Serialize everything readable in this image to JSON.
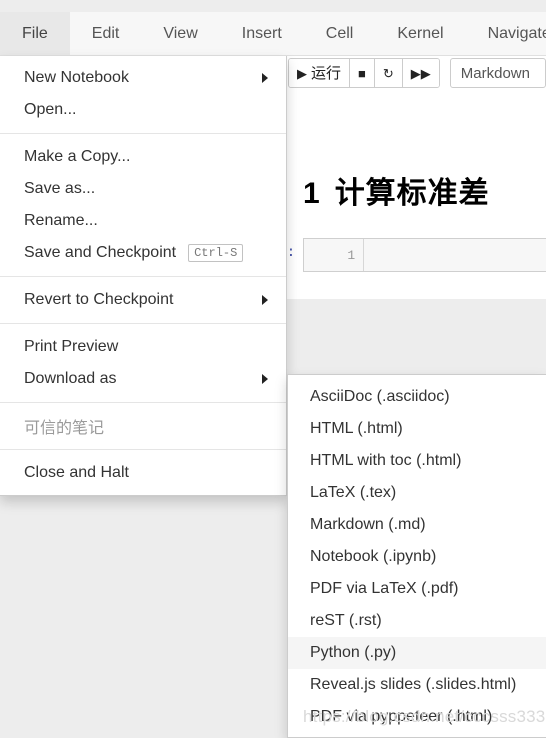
{
  "menubar": {
    "items": [
      {
        "label": "File",
        "active": true
      },
      {
        "label": "Edit",
        "active": false
      },
      {
        "label": "View",
        "active": false
      },
      {
        "label": "Insert",
        "active": false
      },
      {
        "label": "Cell",
        "active": false
      },
      {
        "label": "Kernel",
        "active": false
      },
      {
        "label": "Navigate",
        "active": false
      }
    ]
  },
  "toolbar": {
    "run_glyph": "▶",
    "run_label": "运行",
    "stop_glyph": "■",
    "restart_glyph": "↻",
    "runall_glyph": "▶▶",
    "celltype_value": "Markdown"
  },
  "notebook": {
    "heading_number": "1",
    "heading_text": "计算标准差",
    "prompt": "] :",
    "line_number": "1",
    "cell_code": ""
  },
  "file_menu": {
    "groups": [
      {
        "items": [
          {
            "label": "New Notebook",
            "submenu": true,
            "shortcut": "",
            "disabled": false
          },
          {
            "label": "Open...",
            "submenu": false,
            "shortcut": "",
            "disabled": false
          }
        ]
      },
      {
        "items": [
          {
            "label": "Make a Copy...",
            "submenu": false,
            "shortcut": "",
            "disabled": false
          },
          {
            "label": "Save as...",
            "submenu": false,
            "shortcut": "",
            "disabled": false
          },
          {
            "label": "Rename...",
            "submenu": false,
            "shortcut": "",
            "disabled": false
          },
          {
            "label": "Save and Checkpoint",
            "submenu": false,
            "shortcut": "Ctrl-S",
            "disabled": false
          }
        ]
      },
      {
        "items": [
          {
            "label": "Revert to Checkpoint",
            "submenu": true,
            "shortcut": "",
            "disabled": false
          }
        ]
      },
      {
        "items": [
          {
            "label": "Print Preview",
            "submenu": false,
            "shortcut": "",
            "disabled": false
          },
          {
            "label": "Download as",
            "submenu": true,
            "shortcut": "",
            "disabled": false
          }
        ]
      },
      {
        "items": [
          {
            "label": "可信的笔记",
            "submenu": false,
            "shortcut": "",
            "disabled": true
          }
        ]
      },
      {
        "items": [
          {
            "label": "Close and Halt",
            "submenu": false,
            "shortcut": "",
            "disabled": false
          }
        ]
      }
    ]
  },
  "download_submenu": {
    "items": [
      {
        "label": "AsciiDoc (.asciidoc)",
        "hover": false
      },
      {
        "label": "HTML (.html)",
        "hover": false
      },
      {
        "label": "HTML with toc (.html)",
        "hover": false
      },
      {
        "label": "LaTeX (.tex)",
        "hover": false
      },
      {
        "label": "Markdown (.md)",
        "hover": false
      },
      {
        "label": "Notebook (.ipynb)",
        "hover": false
      },
      {
        "label": "PDF via LaTeX (.pdf)",
        "hover": false
      },
      {
        "label": "reST (.rst)",
        "hover": false
      },
      {
        "label": "Python (.py)",
        "hover": true
      },
      {
        "label": "Reveal.js slides (.slides.html)",
        "hover": false
      },
      {
        "label": "PDF via pyppeteer (.html)",
        "hover": false
      }
    ]
  },
  "watermark": {
    "text": "https://blog.csdn.net/cccsss333"
  },
  "colors": {
    "menubar_bg": "#f7f7f7",
    "active_tab_bg": "#e8e8e8",
    "page_bg": "#ededed",
    "hover_bg": "#f5f5f5",
    "prompt_blue": "#303f9f"
  }
}
